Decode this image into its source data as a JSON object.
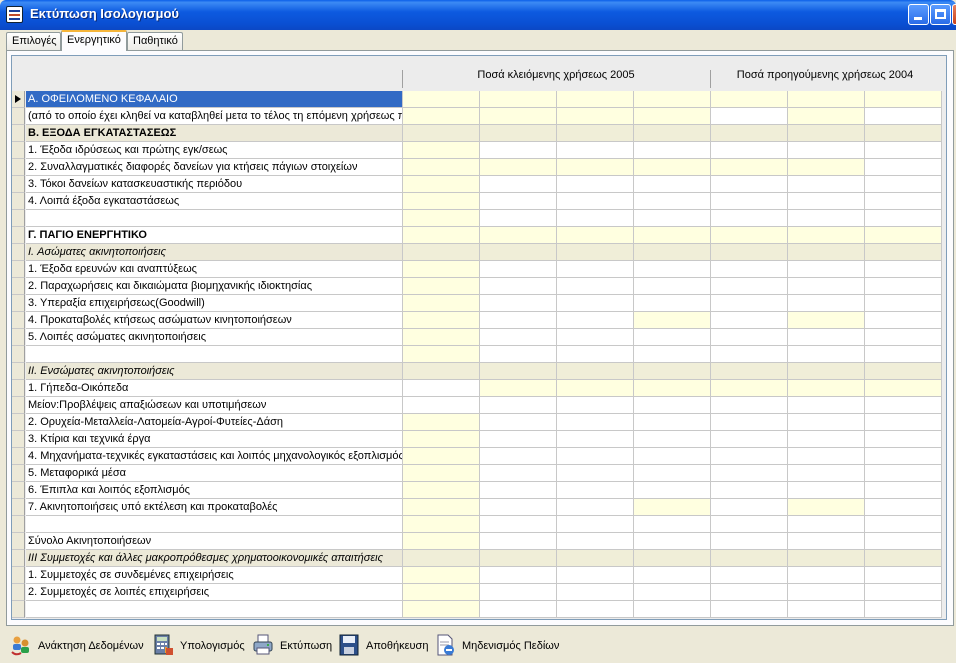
{
  "window": {
    "title": "Εκτύπωση Ισολογισμού"
  },
  "tabs": [
    {
      "label": "Επιλογές",
      "active": false
    },
    {
      "label": "Ενεργητικό",
      "active": true
    },
    {
      "label": "Παθητικό",
      "active": false
    }
  ],
  "grid": {
    "header_2005": "Ποσά κλειόμενης χρήσεως 2005",
    "header_2004": "Ποσά προηγούμενης χρήσεως 2004",
    "rows": [
      {
        "label": "Α. ΟΦΕΙΛΟΜΕΝΟ ΚΕΦΑΛΑΙΟ",
        "style": "sel",
        "cells": "yyyyyyy"
      },
      {
        "label": "(από το οποίο έχει κληθεί να καταβληθεί μετα το τέλος τη επόμενη χρήσεως π",
        "style": "",
        "cells": "yyyywyw"
      },
      {
        "label": "Β. ΕΞΟΔΑ ΕΓΚΑΤΑΣΤΑΣΕΩΣ",
        "style": "b s",
        "cells": "ggggggg"
      },
      {
        "label": "1. Έξοδα ιδρύσεως και πρώτης εγκ/σεως",
        "style": "",
        "cells": "ywwwwww"
      },
      {
        "label": "2. Συναλλαγματικές διαφορές δανείων για κτήσεις πάγιων στοιχείων",
        "style": "",
        "cells": "yyyyyyw"
      },
      {
        "label": "3. Τόκοι δανείων κατασκευαστικής περιόδου",
        "style": "",
        "cells": "ywwwwww"
      },
      {
        "label": "4. Λοιπά έξοδα εγκαταστάσεως",
        "style": "",
        "cells": "ywwwwww"
      },
      {
        "label": "",
        "style": "",
        "cells": "ywwwwww"
      },
      {
        "label": "Γ. ΠΑΓΙΟ ΕΝΕΡΓΗΤΙΚΟ",
        "style": "b",
        "cells": "yyyyyyy"
      },
      {
        "label": "I. Ασώματες ακινητοποιήσεις",
        "style": "i s",
        "cells": "ggggggg"
      },
      {
        "label": "1. Έξοδα ερευνών και αναπτύξεως",
        "style": "",
        "cells": "ywwwwww"
      },
      {
        "label": "2. Παραχωρήσεις και δικαιώματα βιομηχανικής ιδιοκτησίας",
        "style": "",
        "cells": "ywwwwww"
      },
      {
        "label": "3. Υπεραξία επιχειρήσεως(Goodwill)",
        "style": "",
        "cells": "ywwwwww"
      },
      {
        "label": "4. Προκαταβολές κτήσεως ασώματων κινητοποιήσεων",
        "style": "",
        "cells": "ywwywyw"
      },
      {
        "label": "5. Λοιπές ασώματες ακινητοποιήσεις",
        "style": "",
        "cells": "ywwwwww"
      },
      {
        "label": "",
        "style": "",
        "cells": "ywwwwww"
      },
      {
        "label": "II. Ενσώματες ακινητοποιήσεις",
        "style": "i s",
        "cells": "ggggggg"
      },
      {
        "label": "1. Γήπεδα-Οικόπεδα",
        "style": "",
        "cells": "wyyyyyy"
      },
      {
        "label": " Μείον:Προβλέψεις απαξιώσεων και υποτιμήσεων",
        "style": "",
        "cells": "wwwwwww"
      },
      {
        "label": "2. Ορυχεία-Μεταλλεία-Λατομεία-Αγροί-Φυτείες-Δάση",
        "style": "",
        "cells": "ywwwwww"
      },
      {
        "label": "3. Κτίρια και τεχνικά έργα",
        "style": "",
        "cells": "ywwwwww"
      },
      {
        "label": "4. Μηχανήματα-τεχνικές εγκαταστάσεις και λοιπός μηχανολογικός εξοπλισμός",
        "style": "",
        "cells": "ywwwwww"
      },
      {
        "label": "5. Μεταφορικά μέσα",
        "style": "",
        "cells": "ywwwwww"
      },
      {
        "label": "6. Έπιπλα και λοιπός εξοπλισμός",
        "style": "",
        "cells": "ywwwwww"
      },
      {
        "label": "7. Ακινητοποιήσεις υπό εκτέλεση και προκαταβολές",
        "style": "",
        "cells": "ywwywyw"
      },
      {
        "label": "",
        "style": "",
        "cells": "ywwwwww"
      },
      {
        "label": "Σύνολο Ακινητοποιήσεων",
        "style": "",
        "cells": "ywwwwww"
      },
      {
        "label": "III Συμμετοχές και άλλες μακροπρόθεσμες χρηματοοικονομικές απαιτήσεις",
        "style": "i s",
        "cells": "ggggggg"
      },
      {
        "label": "1. Συμμετοχές σε συνδεμένες επιχειρήσεις",
        "style": "",
        "cells": "ywwwwww"
      },
      {
        "label": "2. Συμμετοχές σε λοιπές επιχειρήσεις",
        "style": "",
        "cells": "ywwwwww"
      },
      {
        "label": "",
        "style": "",
        "cells": "ywwwwww"
      }
    ]
  },
  "toolbar": [
    {
      "label": "Ανάκτηση Δεδομένων",
      "icon": "users-refresh-icon"
    },
    {
      "label": "Υπολογισμός",
      "icon": "calculator-icon"
    },
    {
      "label": "Εκτύπωση",
      "icon": "printer-icon"
    },
    {
      "label": "Αποθήκευση",
      "icon": "save-disk-icon"
    },
    {
      "label": "Μηδενισμός Πεδίων",
      "icon": "clear-document-icon"
    }
  ],
  "colors": {
    "title_bar": "#0a4fd2",
    "selection": "#316ac5",
    "cell_highlight": "#ffffe0",
    "window_bg": "#ece9d8"
  }
}
